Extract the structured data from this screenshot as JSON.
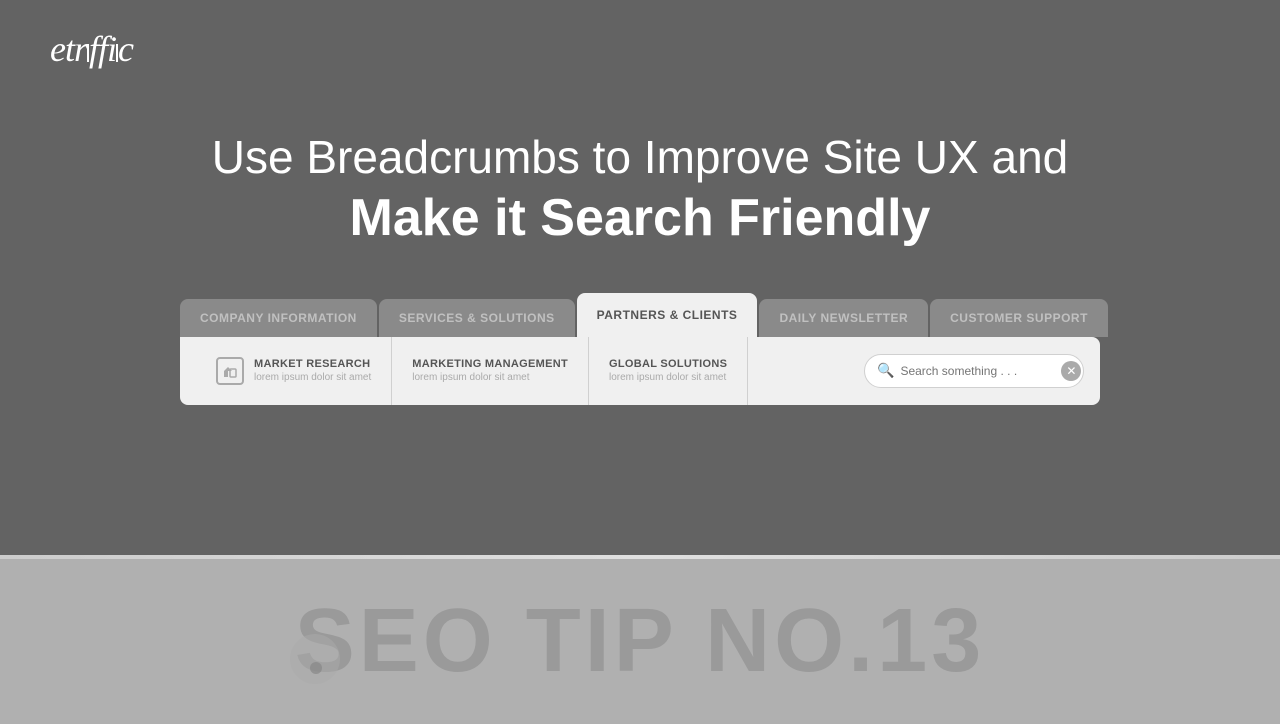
{
  "logo": {
    "text": "etraffic"
  },
  "headline": {
    "line1": "Use Breadcrumbs to Improve Site UX and",
    "line2": "Make it Search Friendly"
  },
  "tabs": [
    {
      "label": "COMPANY INFORMATION",
      "active": false
    },
    {
      "label": "SERVICES & SOLUTIONS",
      "active": false
    },
    {
      "label": "PARTNERS & CLIENTS",
      "active": true
    },
    {
      "label": "DAILY NEWSLETTER",
      "active": false
    },
    {
      "label": "CUSTOMER SUPPORT",
      "active": false
    }
  ],
  "menu_items": [
    {
      "title": "MARKET RESEARCH",
      "subtitle": "lorem ipsum dolor sit amet",
      "has_icon": true
    },
    {
      "title": "MARKETING MANAGEMENT",
      "subtitle": "lorem ipsum dolor sit amet",
      "has_icon": false
    },
    {
      "title": "GLOBAL SOLUTIONS",
      "subtitle": "lorem ipsum dolor sit amet",
      "has_icon": false
    }
  ],
  "search": {
    "placeholder": "Search something . . ."
  },
  "seo_tip": {
    "text": "SEO TIP NO.13"
  }
}
